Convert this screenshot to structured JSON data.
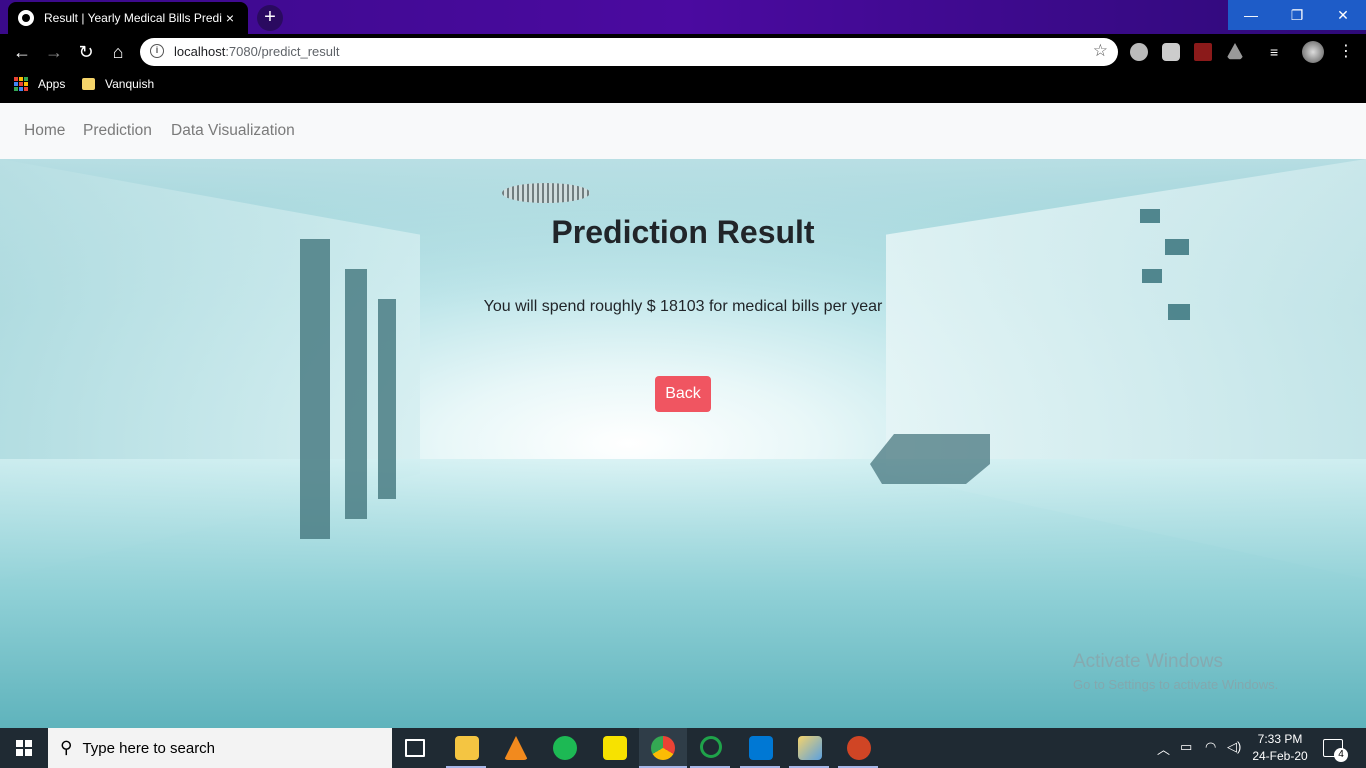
{
  "browser": {
    "tab_title": "Result | Yearly Medical Bills Predic",
    "tab_close": "×",
    "new_tab": "+",
    "url_host": "localhost",
    "url_rest": ":7080/predict_result",
    "window_controls": {
      "minimize": "—",
      "maximize": "❐",
      "close": "✕"
    },
    "nav": {
      "back": "←",
      "forward": "→",
      "reload": "↻",
      "home": "⌂"
    },
    "bookmarks": [
      {
        "label": "Apps"
      },
      {
        "label": "Vanquish"
      }
    ]
  },
  "page": {
    "nav": [
      {
        "label": "Home"
      },
      {
        "label": "Prediction"
      },
      {
        "label": "Data Visualization"
      }
    ],
    "title": "Prediction Result",
    "result_text": "You will spend roughly $ 18103 for medical bills per year",
    "back_label": "Back",
    "accent": "#f05561"
  },
  "watermark": {
    "line1": "Activate Windows",
    "line2": "Go to Settings to activate Windows."
  },
  "taskbar": {
    "search_placeholder": "Type here to search",
    "time": "7:33 PM",
    "date": "24-Feb-20",
    "notifications": "4",
    "apps": [
      "task-view",
      "file-explorer",
      "vlc",
      "spotify",
      "sticky-notes",
      "chrome",
      "app-circle",
      "vscode",
      "paint",
      "powerpoint"
    ]
  }
}
